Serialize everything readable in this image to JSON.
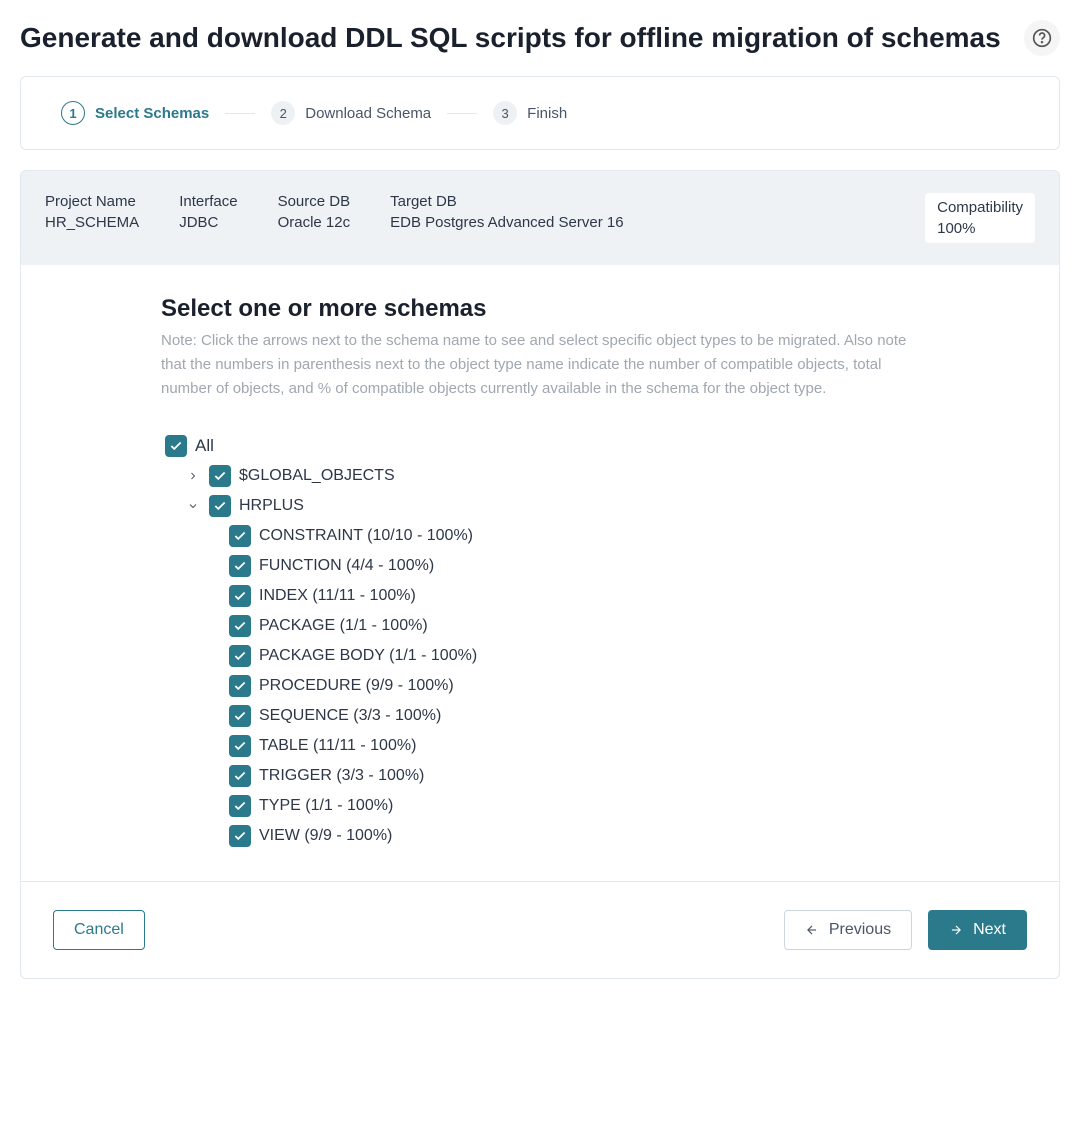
{
  "page": {
    "title": "Generate and download DDL SQL scripts for offline migration of schemas"
  },
  "stepper": {
    "steps": [
      {
        "num": "1",
        "label": "Select Schemas",
        "active": true
      },
      {
        "num": "2",
        "label": "Download Schema",
        "active": false
      },
      {
        "num": "3",
        "label": "Finish",
        "active": false
      }
    ]
  },
  "info": {
    "project_name_label": "Project Name",
    "project_name": "HR_SCHEMA",
    "interface_label": "Interface",
    "interface": "JDBC",
    "source_db_label": "Source DB",
    "source_db": "Oracle 12c",
    "target_db_label": "Target DB",
    "target_db": "EDB Postgres Advanced Server 16",
    "compatibility_label": "Compatibility",
    "compatibility": "100%"
  },
  "section": {
    "title": "Select one or more schemas",
    "note": "Note: Click the arrows next to the schema name to see and select specific object types to be migrated. Also note that the numbers in parenthesis next to the object type name indicate the number of compatible objects, total number of objects, and % of compatible objects currently available in the schema for the object type."
  },
  "tree": {
    "all_label": "All",
    "schema1": {
      "label": "$GLOBAL_OBJECTS"
    },
    "schema2": {
      "label": "HRPLUS",
      "items": [
        "CONSTRAINT (10/10 - 100%)",
        "FUNCTION (4/4 - 100%)",
        "INDEX (11/11 - 100%)",
        "PACKAGE (1/1 - 100%)",
        "PACKAGE BODY (1/1 - 100%)",
        "PROCEDURE (9/9 - 100%)",
        "SEQUENCE (3/3 - 100%)",
        "TABLE (11/11 - 100%)",
        "TRIGGER (3/3 - 100%)",
        "TYPE (1/1 - 100%)",
        "VIEW (9/9 - 100%)"
      ]
    }
  },
  "footer": {
    "cancel": "Cancel",
    "previous": "Previous",
    "next": "Next"
  }
}
